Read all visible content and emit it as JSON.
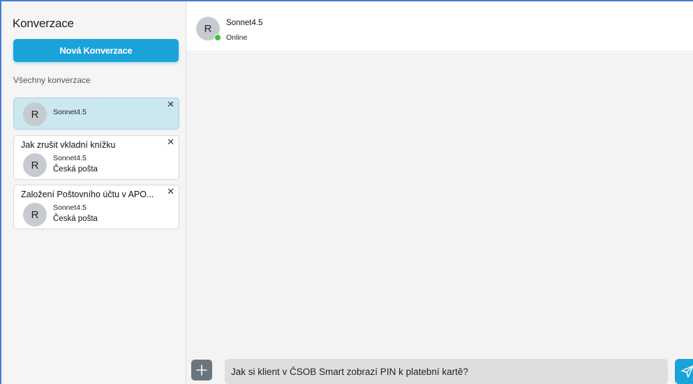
{
  "sidebar": {
    "title": "Konverzace",
    "new_button": "Nová Konverzace",
    "section_label": "Všechny konverzace",
    "conversations": [
      {
        "title": "",
        "avatar": "R",
        "name": "Sonnet4.5",
        "subtitle": "",
        "active": true
      },
      {
        "title": "Jak zrušit vkladní knížku",
        "avatar": "R",
        "name": "Sonnet4.5",
        "subtitle": "Česká pošta",
        "active": false
      },
      {
        "title": "Založení Poštovního účtu v APO...",
        "avatar": "R",
        "name": "Sonnet4.5",
        "subtitle": "Česká pošta",
        "active": false
      }
    ],
    "close_glyph": "✕"
  },
  "header": {
    "avatar": "R",
    "name": "Sonnet4.5",
    "status": "Online"
  },
  "composer": {
    "plus_glyph": "+",
    "input_value": "Jak si klient v ČSOB Smart zobrazí PIN k platební kartě?"
  },
  "colors": {
    "accent": "#1aa3d9",
    "active_card": "#cbe7f0",
    "online": "#3cc23c",
    "plus_button": "#6b757d"
  },
  "icons": {
    "close": "close-icon",
    "add": "plus-icon",
    "send": "send-icon",
    "status": "online-status-icon"
  }
}
